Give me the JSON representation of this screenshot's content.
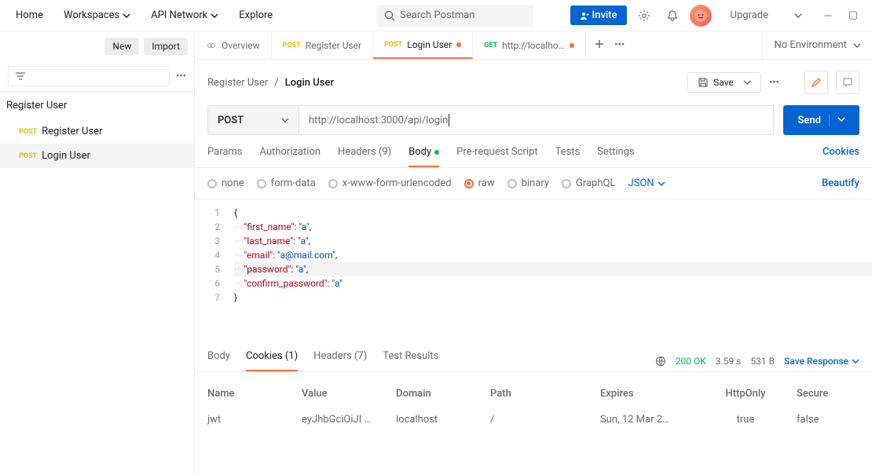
{
  "topbar": {
    "nav": [
      "Home",
      "Workspaces",
      "API Network",
      "Explore"
    ],
    "search_placeholder": "Search Postman",
    "invite": "Invite",
    "upgrade": "Upgrade"
  },
  "sidebar": {
    "new": "New",
    "import": "Import",
    "collection": "Register User",
    "items": [
      {
        "method": "POST",
        "name": "Register User"
      },
      {
        "method": "POST",
        "name": "Login User"
      }
    ]
  },
  "tabs": {
    "overview": "Overview",
    "items": [
      {
        "method": "POST",
        "label": "Register User",
        "dot": false
      },
      {
        "method": "POST",
        "label": "Login User",
        "dot": true
      },
      {
        "method": "GET",
        "label": "http://localhost:",
        "dot": true,
        "dotColor": "green"
      }
    ],
    "env": "No Environment"
  },
  "breadcrumb": {
    "parent": "Register User",
    "current": "Login User",
    "save": "Save"
  },
  "request": {
    "method": "POST",
    "url": "http://localhost:3000/api/login",
    "tabs": [
      "Params",
      "Authorization",
      "Headers (9)",
      "Body",
      "Pre-request Script",
      "Tests",
      "Settings"
    ],
    "active_tab": "Body",
    "cookies_link": "Cookies"
  },
  "body_opts": {
    "opts": [
      "none",
      "form-data",
      "x-www-form-urlencoded",
      "raw",
      "binary",
      "GraphQL"
    ],
    "selected": "raw",
    "lang": "JSON",
    "beautify": "Beautify"
  },
  "editor": {
    "lines": [
      "1",
      "2",
      "3",
      "4",
      "5",
      "6",
      "7"
    ],
    "body": {
      "first_name": "a",
      "last_name": "a",
      "email": "a@mail.com",
      "password": "a",
      "confirm_password": "a"
    }
  },
  "response": {
    "tabs": [
      "Body",
      "Cookies (1)",
      "Headers (7)",
      "Test Results"
    ],
    "active_tab": "Cookies (1)",
    "status": "200 OK",
    "time": "3.59 s",
    "size": "531 B",
    "save": "Save Response"
  },
  "cookies_table": {
    "headers": [
      "Name",
      "Value",
      "Domain",
      "Path",
      "Expires",
      "HttpOnly",
      "Secure"
    ],
    "rows": [
      {
        "name": "jwt",
        "value": "eyJhbGciOiJI …",
        "domain": "localhost",
        "path": "/",
        "expires": "Sun, 12 Mar 2…",
        "httpOnly": "true",
        "secure": "false"
      }
    ]
  },
  "send_label": "Send"
}
